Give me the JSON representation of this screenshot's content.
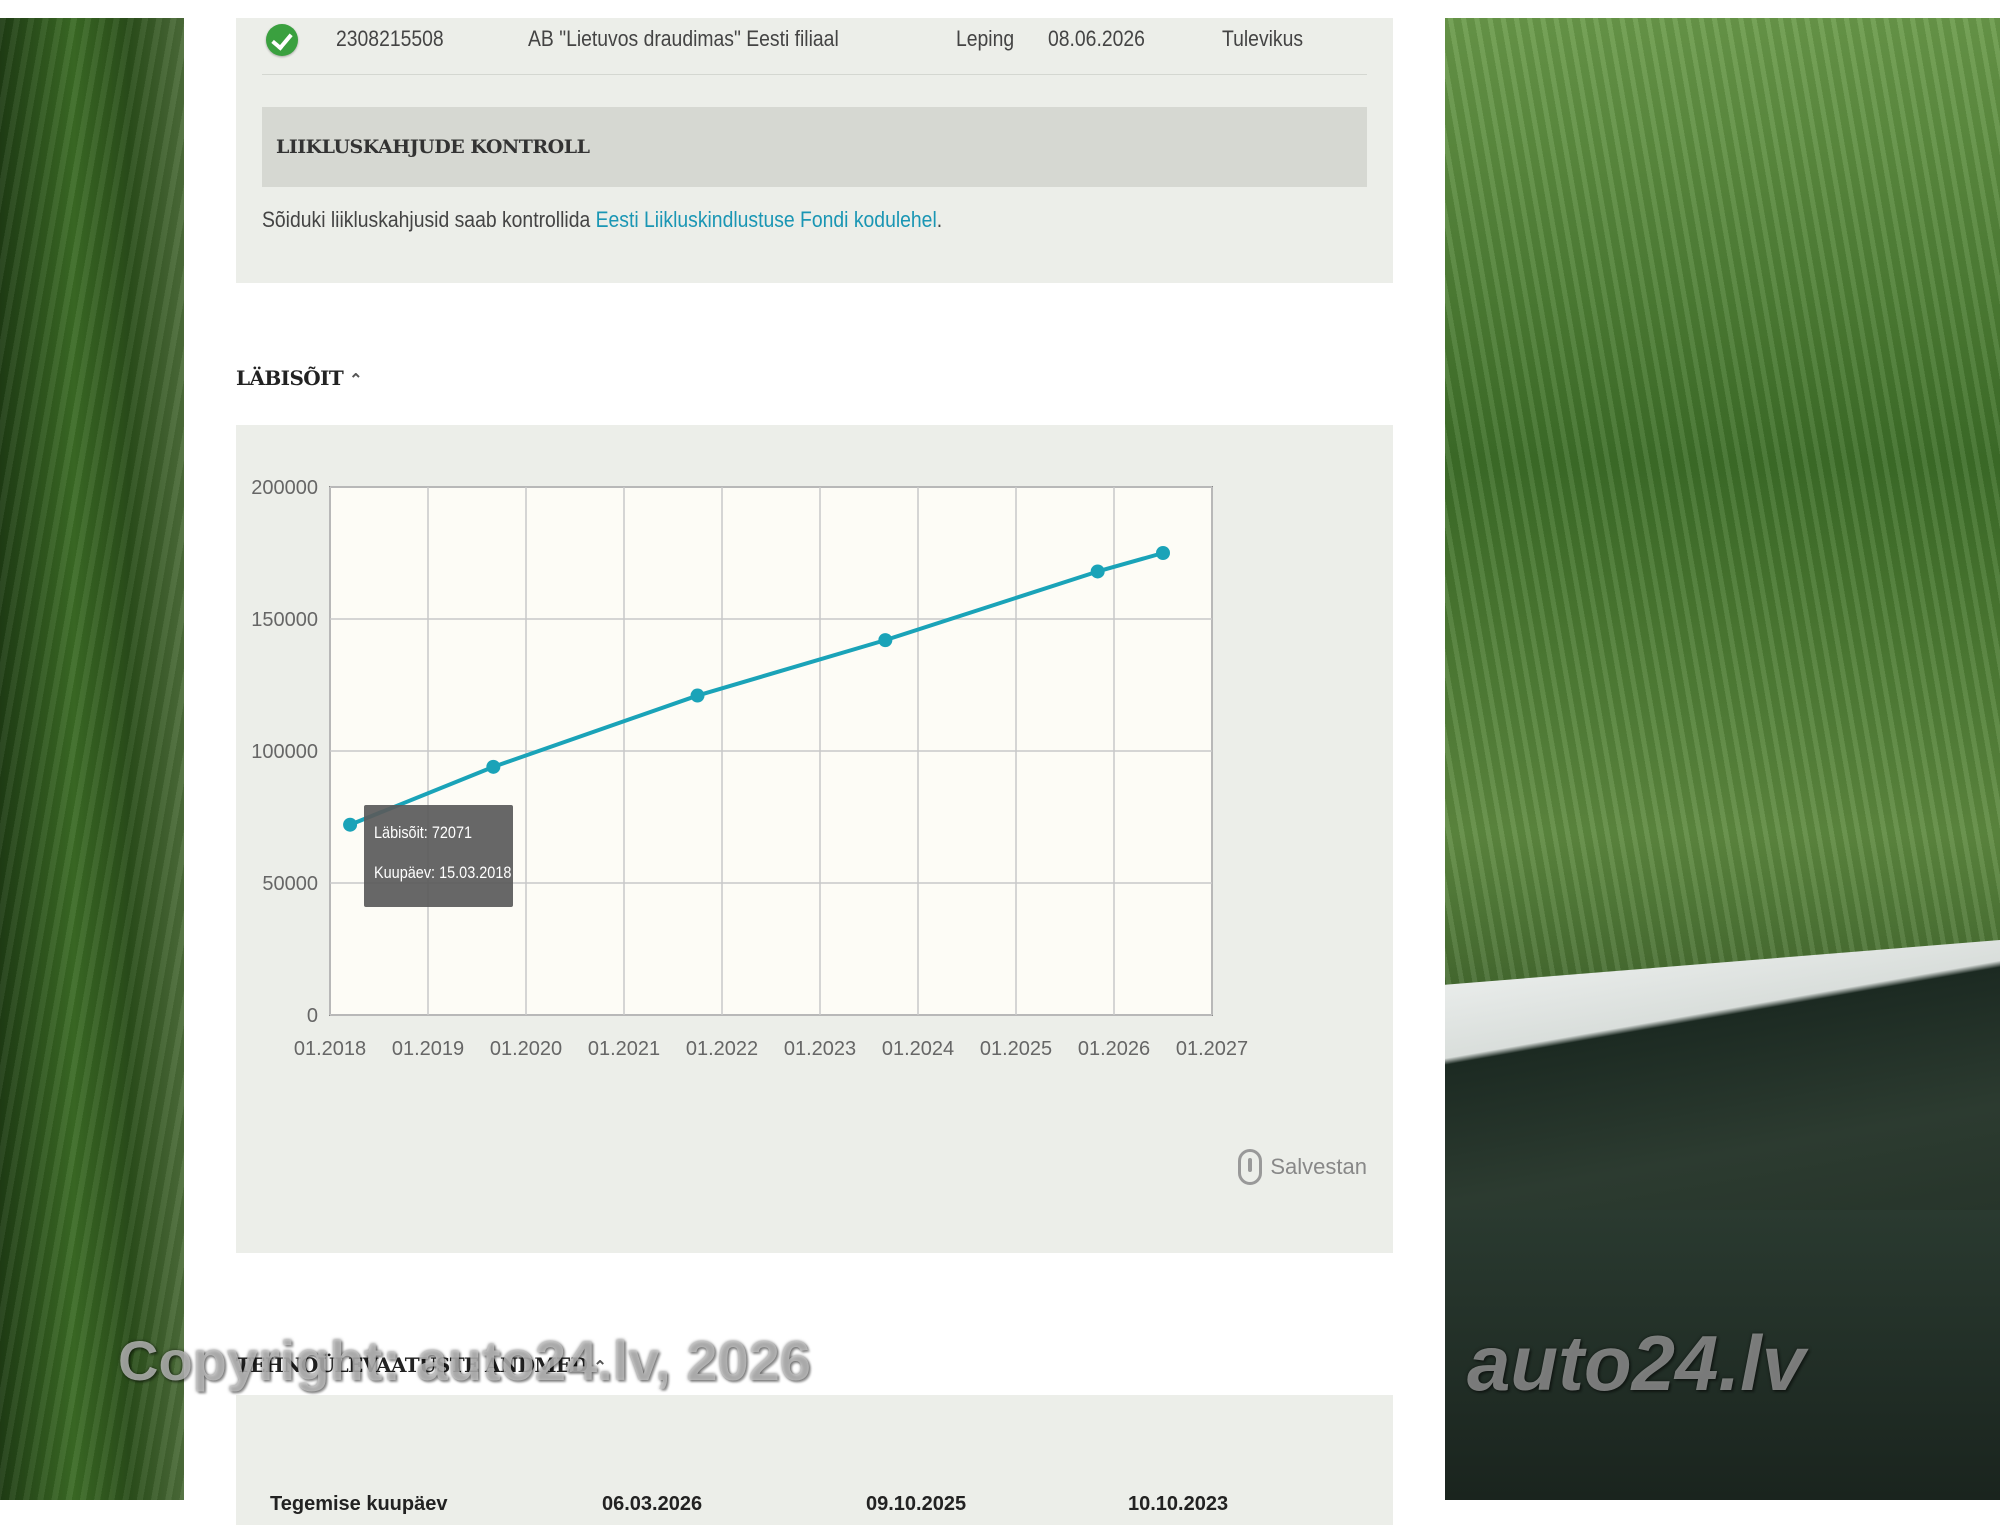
{
  "insurance": {
    "number": "2308215508",
    "insurer": "AB \"Lietuvos draudimas\" Eesti filiaal",
    "type": "Leping",
    "date": "08.06.2026",
    "status": "Tulevikus"
  },
  "traffic": {
    "heading": "LIIKLUSKAHJUDE KONTROLL",
    "text": "Sõiduki liikluskahjusid saab kontrollida ",
    "link": "Eesti Liikluskindlustuse Fondi kodulehel",
    "text_end": "."
  },
  "mileage": {
    "title": "LÄBISÕIT",
    "save_label": "Salvestan",
    "tooltip": {
      "mileage_label": "Läbisõit:",
      "mileage_value": "72071",
      "date_label": "Kuupäev:",
      "date_value": "15.03.2018"
    }
  },
  "chart_data": {
    "type": "line",
    "x_tick_labels": [
      "01.2018",
      "01.2019",
      "01.2020",
      "01.2021",
      "01.2022",
      "01.2023",
      "01.2024",
      "01.2025",
      "01.2026",
      "01.2027"
    ],
    "y_tick_labels": [
      "0",
      "50000",
      "100000",
      "150000",
      "200000"
    ],
    "ylim": [
      0,
      200000
    ],
    "xlim": [
      "01.2018",
      "01.2027"
    ],
    "grid": true,
    "points": [
      {
        "date": "15.03.2018",
        "value": 72071
      },
      {
        "date": "09.2019",
        "value": 94000
      },
      {
        "date": "10.2021",
        "value": 121000
      },
      {
        "date": "09.2023",
        "value": 142000
      },
      {
        "date": "11.2025",
        "value": 168000
      },
      {
        "date": "07.2026",
        "value": 175000
      }
    ],
    "line_color": "#1aa3b8"
  },
  "tech": {
    "title": "TEHNOÜLEVAATUSTE ANDMED",
    "row_label": "Tegemise kuupäev",
    "dates": [
      "06.03.2026",
      "09.10.2025",
      "10.10.2023"
    ]
  },
  "watermarks": {
    "left": "Copyright: auto24.lv, 2026",
    "right": "auto24.lv"
  }
}
